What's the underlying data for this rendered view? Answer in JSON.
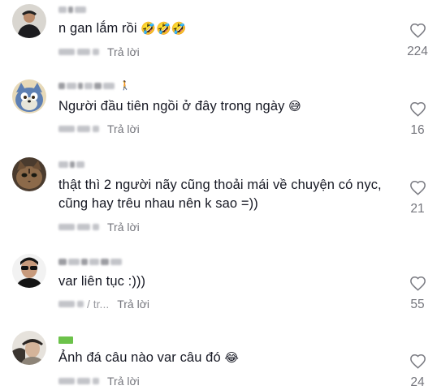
{
  "comments": [
    {
      "text": "n gan lắm rồi",
      "emojis": "🤣🤣🤣",
      "date_fragment": "",
      "reply_label": "Trả lời",
      "likes": "224",
      "avatar": "person-black-jacket"
    },
    {
      "text": "Người đầu tiên ngồi ở đây trong ngày",
      "emojis": "😅",
      "date_fragment": "",
      "reply_label": "Trả lời",
      "likes": "16",
      "avatar": "tom-cat-cartoon"
    },
    {
      "text": "thật thì 2 người nãy cũng thoải mái về chuyện có nyc, cũng hay trêu nhau nên k sao =))",
      "emojis": "",
      "date_fragment": "",
      "reply_label": "Trả lời",
      "likes": "21",
      "avatar": "cat-face"
    },
    {
      "text": "var liên tục :)))",
      "emojis": "",
      "date_fragment": "/ tr...",
      "reply_label": "Trả lời",
      "likes": "55",
      "avatar": "person-sunglasses"
    },
    {
      "text": "Ảnh đá câu nào var câu đó",
      "emojis": "😂",
      "date_fragment": "",
      "reply_label": "Trả lời",
      "likes": "24",
      "avatar": "person-hat"
    }
  ],
  "colors": {
    "text": "#161823",
    "secondary": "#8a8b91",
    "heart_stroke": "#7c7d84"
  },
  "icons": {
    "like": "heart-outline-icon"
  }
}
